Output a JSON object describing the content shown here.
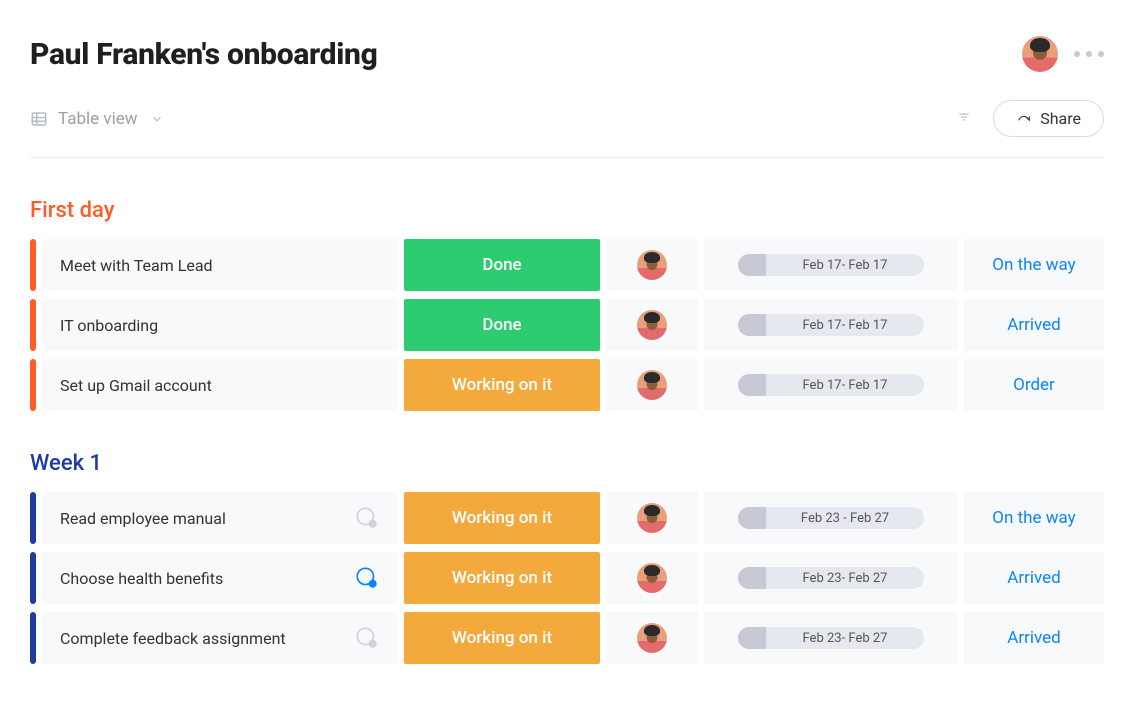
{
  "header": {
    "title": "Paul Franken's onboarding"
  },
  "toolbar": {
    "view_label": "Table view",
    "share_label": "Share"
  },
  "groups": [
    {
      "id": "first-day",
      "title": "First day",
      "accent": "#ff5c26",
      "rows": [
        {
          "task": "Meet with Team Lead",
          "chat": "none",
          "status_label": "Done",
          "status_kind": "done",
          "date": "Feb 17- Feb 17",
          "link": "On the way"
        },
        {
          "task": "IT onboarding",
          "chat": "none",
          "status_label": "Done",
          "status_kind": "done",
          "date": "Feb 17- Feb 17",
          "link": "Arrived"
        },
        {
          "task": "Set up Gmail account",
          "chat": "none",
          "status_label": "Working on it",
          "status_kind": "working",
          "date": "Feb 17- Feb 17",
          "link": "Order"
        }
      ]
    },
    {
      "id": "week-1",
      "title": "Week 1",
      "accent": "#1f3c9e",
      "rows": [
        {
          "task": "Read employee manual",
          "chat": "muted",
          "status_label": "Working on it",
          "status_kind": "working",
          "date": "Feb 23 - Feb 27",
          "link": "On the way"
        },
        {
          "task": "Choose health benefits",
          "chat": "active",
          "status_label": "Working on it",
          "status_kind": "working",
          "date": "Feb 23- Feb 27",
          "link": "Arrived"
        },
        {
          "task": "Complete feedback assignment",
          "chat": "muted",
          "status_label": "Working on it",
          "status_kind": "working",
          "date": "Feb 23- Feb 27",
          "link": "Arrived"
        }
      ]
    }
  ]
}
